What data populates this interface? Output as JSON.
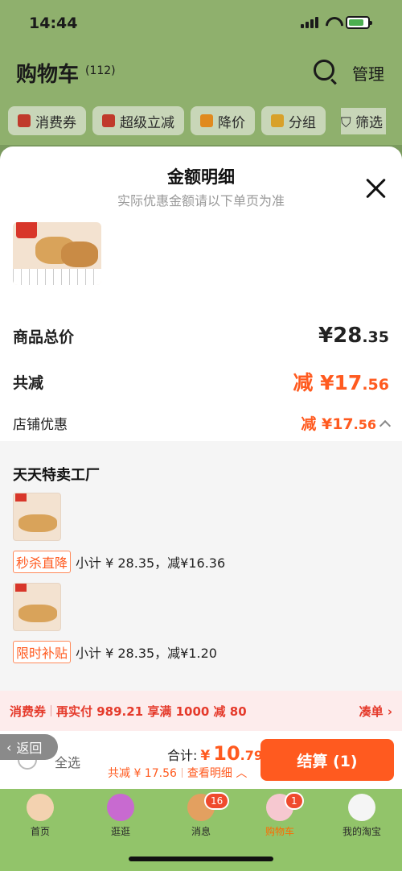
{
  "status": {
    "time": "14:44"
  },
  "header": {
    "title": "购物车",
    "count": "(112)",
    "manage": "管理"
  },
  "filters": {
    "chips": [
      "消费券",
      "超级立减",
      "降价",
      "分组"
    ],
    "filter_label": "筛选"
  },
  "sheet": {
    "title": "金额明细",
    "subtitle": "实际优惠金额请以下单页为准",
    "total_label": "商品总价",
    "total_currency": "¥",
    "total_int": "28",
    "total_dec": ".35",
    "discount_label": "共减",
    "discount_prefix": "减 ¥",
    "discount_int": "17",
    "discount_dec": ".56",
    "shop_discount_label": "店铺优惠",
    "shop_discount_prefix": "减 ¥",
    "shop_discount_int": "17",
    "shop_discount_dec": ".56",
    "shop_name": "天天特卖工厂",
    "promos": [
      {
        "tag": "秒杀直降",
        "text": "小计 ¥ 28.35，减¥16.36"
      },
      {
        "tag": "限时补贴",
        "text": "小计 ¥ 28.35，减¥1.20"
      }
    ]
  },
  "coupon_bar": {
    "label": "消费券",
    "text": "再实付 989.21 享满 1000 减 80",
    "action": "凑单"
  },
  "bottom": {
    "back": "返回",
    "select_all": "全选",
    "sum_label": "合计:",
    "sum_currency": "¥",
    "sum_int": "10",
    "sum_dec": ".79",
    "total_discount": "共减 ¥ 17.56",
    "view_detail": "查看明细",
    "checkout": "结算 (1)"
  },
  "tabs": [
    {
      "label": "首页"
    },
    {
      "label": "逛逛"
    },
    {
      "label": "消息",
      "badge": "16"
    },
    {
      "label": "购物车",
      "badge": "1"
    },
    {
      "label": "我的淘宝"
    }
  ]
}
